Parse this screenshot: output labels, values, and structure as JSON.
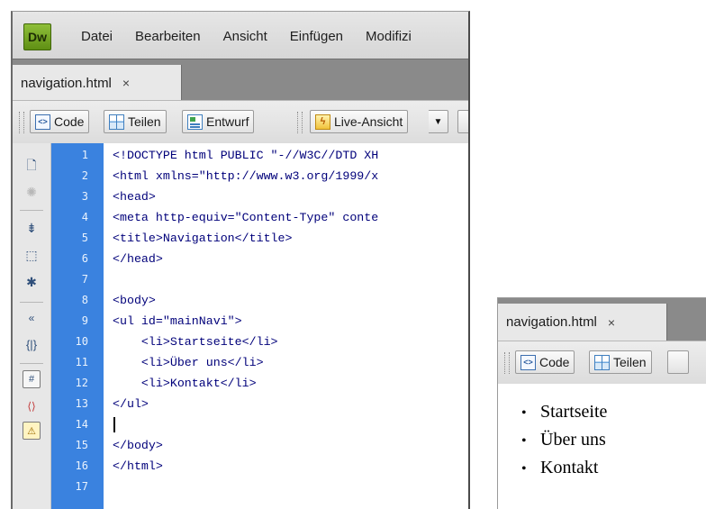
{
  "app": {
    "logo_text": "Dw",
    "menu": [
      "Datei",
      "Bearbeiten",
      "Ansicht",
      "Einfügen",
      "Modifizi"
    ]
  },
  "document": {
    "tab_label": "navigation.html",
    "tab_close": "×"
  },
  "doc_toolbar": {
    "code_label": "Code",
    "split_label": "Teilen",
    "design_label": "Entwurf",
    "live_label": "Live-Ansicht",
    "dropdown_glyph": "▼"
  },
  "coding_toolbar_icons": [
    "open-documents-icon",
    "show-code-navigator-icon",
    "collapse-full-tag-icon",
    "collapse-selection-icon",
    "expand-all-icon",
    "select-parent-tag-icon",
    "balance-braces-icon",
    "line-numbers-icon",
    "highlight-invalid-code-icon",
    "syntax-error-alerts-icon"
  ],
  "code": {
    "line_numbers": [
      "1",
      "2",
      "3",
      "4",
      "5",
      "6",
      "7",
      "8",
      "9",
      "10",
      "11",
      "12",
      "13",
      "14",
      "15",
      "16",
      "17"
    ],
    "lines": [
      "<!DOCTYPE html PUBLIC \"-//W3C//DTD XH",
      "<html xmlns=\"http://www.w3.org/1999/x",
      "<head>",
      "<meta http-equiv=\"Content-Type\" conte",
      "<title>Navigation</title>",
      "</head>",
      "",
      "<body>",
      "<ul id=\"mainNavi\">",
      "    <li>Startseite</li>",
      "    <li>Über uns</li>",
      "    <li>Kontakt</li>",
      "</ul>",
      "",
      "</body>",
      "</html>",
      ""
    ],
    "caret_line": 14
  },
  "preview": {
    "tab_label": "navigation.html",
    "tab_close": "×",
    "code_label": "Code",
    "split_label": "Teilen",
    "bullet": "•",
    "items": [
      "Startseite",
      "Über uns",
      "Kontakt"
    ]
  }
}
